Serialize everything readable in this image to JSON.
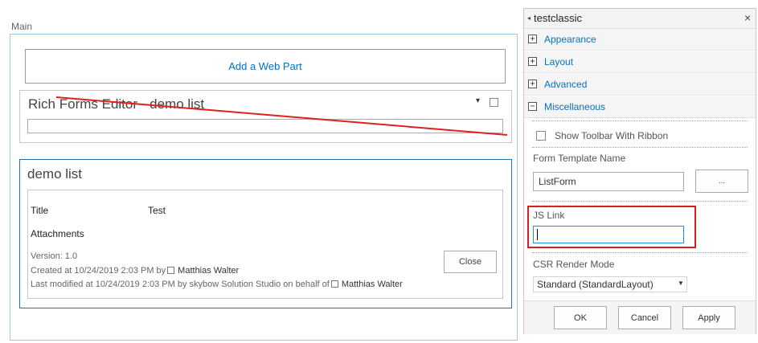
{
  "main": {
    "zone_title": "Main",
    "add_web_part": "Add a Web Part",
    "webpart1": {
      "title": "Rich Forms Editor - demo list",
      "chevron": "▾"
    },
    "webpart2": {
      "title": "demo list",
      "fields": [
        {
          "label": "Title",
          "value": "Test"
        },
        {
          "label": "Attachments",
          "value": ""
        }
      ],
      "version": "Version: 1.0",
      "created_prefix": "Created at 10/24/2019 2:03 PM  by",
      "created_by": "Matthias Walter",
      "modified_prefix": "Last modified at 10/24/2019 2:03 PM  by skybow Solution Studio on behalf of",
      "modified_by": "Matthias Walter",
      "close_label": "Close"
    }
  },
  "tool_pane": {
    "title": "testclassic",
    "close_glyph": "×",
    "collapse_glyph": "◂",
    "sections": [
      {
        "label": "Appearance",
        "state": "+"
      },
      {
        "label": "Layout",
        "state": "+"
      },
      {
        "label": "Advanced",
        "state": "+"
      },
      {
        "label": "Miscellaneous",
        "state": "−"
      }
    ],
    "show_toolbar_label": "Show Toolbar With Ribbon",
    "form_template_label": "Form Template Name",
    "form_template_value": "ListForm",
    "ellipsis_label": "...",
    "js_link_label": "JS Link",
    "js_link_value": "",
    "csr_label": "CSR Render Mode",
    "csr_value": "Standard (StandardLayout)",
    "csr_arrow": "▼",
    "buttons": {
      "ok": "OK",
      "cancel": "Cancel",
      "apply": "Apply"
    }
  },
  "colors": {
    "link": "#0072c6",
    "annotation_red": "#d12126",
    "zone_border": "#9ec6dd"
  }
}
